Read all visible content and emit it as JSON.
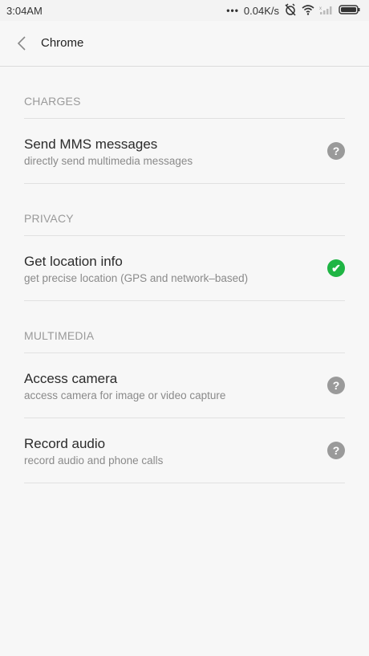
{
  "status_bar": {
    "time": "3:04AM",
    "dots": "•••",
    "net_speed": "0.04K/s"
  },
  "header": {
    "title": "Chrome",
    "back_icon": "chevron-left-icon"
  },
  "sections": [
    {
      "header": "CHARGES",
      "items": [
        {
          "title": "Send MMS messages",
          "desc": "directly send multimedia messages",
          "status": "ask",
          "status_glyph": "?"
        }
      ]
    },
    {
      "header": "PRIVACY",
      "items": [
        {
          "title": "Get location info",
          "desc": "get precise location (GPS and network–based)",
          "status": "allow",
          "status_glyph": "✔"
        }
      ]
    },
    {
      "header": "MULTIMEDIA",
      "items": [
        {
          "title": "Access camera",
          "desc": "access camera for image or video capture",
          "status": "ask",
          "status_glyph": "?"
        },
        {
          "title": "Record audio",
          "desc": "record audio and phone calls",
          "status": "ask",
          "status_glyph": "?"
        }
      ]
    }
  ],
  "colors": {
    "allow": "#1fb544",
    "ask": "#9a9a9a"
  }
}
